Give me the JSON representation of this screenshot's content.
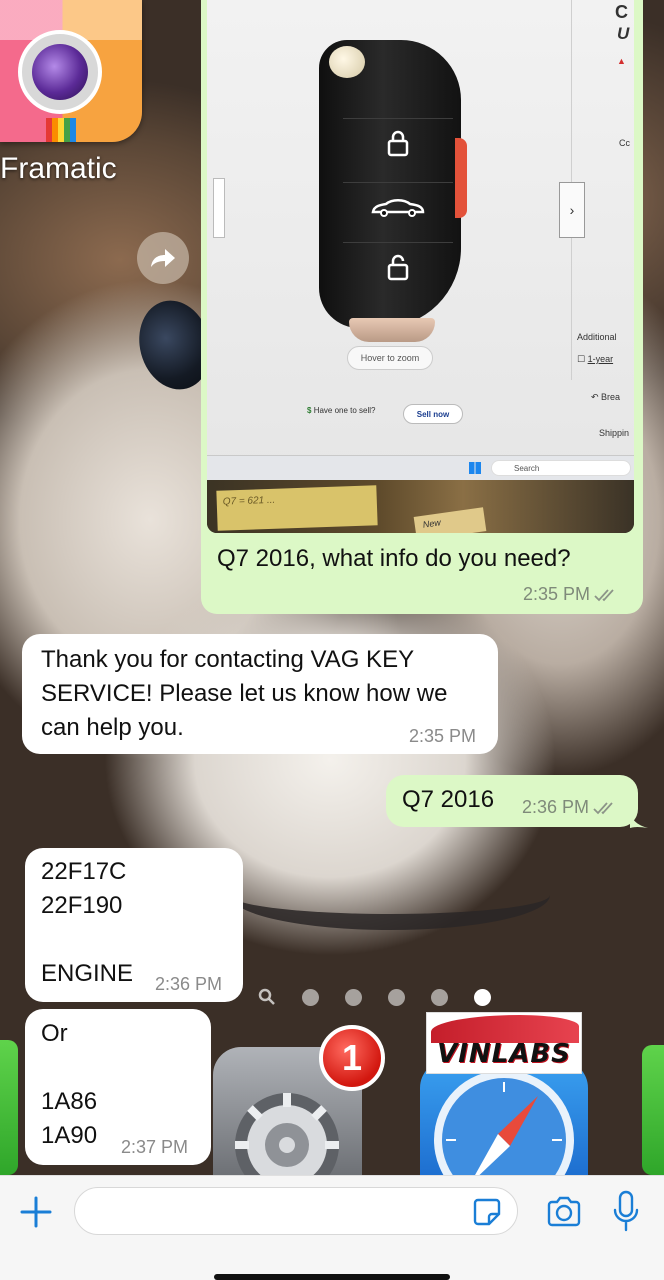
{
  "home_screen": {
    "app_label": "Framatic",
    "badge_count": "1",
    "vinlabs_logo_text": "VINLABS"
  },
  "messages": [
    {
      "direction": "outgoing",
      "type": "image",
      "caption": "Q7 2016, what info do you need?",
      "time": "2:35 PM",
      "status": "read",
      "photo_content": {
        "hover_zoom": "Hover to zoom",
        "sell_prompt": "Have one to sell?",
        "sell_button": "Sell now",
        "search_text": "Search",
        "side_additional": "Additional",
        "side_year": "1-year",
        "side_brea": "Brea",
        "side_shipping": "Shippin",
        "side_cc": "Cc",
        "side_top_c": "C",
        "side_top_u": "U",
        "note_text": "Q7 = 621 ...",
        "note_new": "New"
      }
    },
    {
      "direction": "incoming",
      "type": "text",
      "text": "Thank you for contacting VAG KEY\nSERVICE! Please let us know how we\ncan help you.",
      "time": "2:35 PM"
    },
    {
      "direction": "outgoing",
      "type": "text",
      "text": "Q7 2016",
      "time": "2:36 PM",
      "status": "read"
    },
    {
      "direction": "incoming",
      "type": "text",
      "text": "22F17C\n22F190\n\nENGINE",
      "time": "2:36 PM"
    },
    {
      "direction": "incoming",
      "type": "text",
      "text": "Or\n\n1A86\n1A90",
      "time": "2:37 PM"
    }
  ],
  "input_bar": {
    "placeholder": "",
    "icons": [
      "plus-icon",
      "sticker-icon",
      "camera-icon",
      "microphone-icon"
    ],
    "accent_color": "#1a7ed6"
  },
  "colors": {
    "outgoing_bubble": "#dcf8c6",
    "incoming_bubble": "#ffffff",
    "read_ticks": "#7f8a7a"
  },
  "home_page_dots": {
    "count": 5,
    "active_index": 4
  }
}
